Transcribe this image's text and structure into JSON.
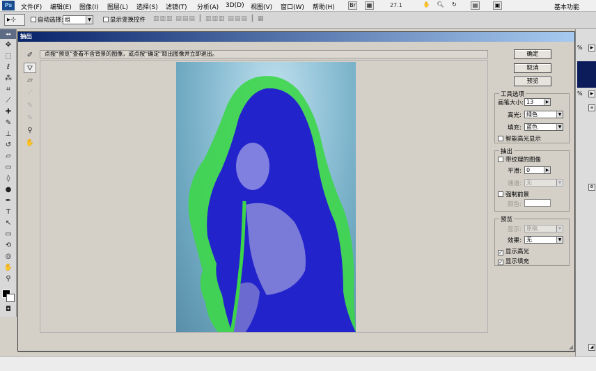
{
  "menubar": {
    "logo": "Ps",
    "items": [
      "文件(F)",
      "编辑(E)",
      "图像(I)",
      "图层(L)",
      "选择(S)",
      "滤镜(T)",
      "分析(A)",
      "3D(D)",
      "视图(V)",
      "窗口(W)",
      "帮助(H)"
    ],
    "zoom": "27.1",
    "workspace": "基本功能"
  },
  "optionsbar": {
    "auto_select_label": "自动选择:",
    "auto_select_value": "组",
    "show_transform_label": "显示变换控件"
  },
  "dialog": {
    "title": "抽出",
    "instruction": "点按“预览”查看不含背景的图像，或点按“确定”取出图像并立即退出。",
    "buttons": {
      "ok": "确定",
      "cancel": "取消",
      "preview": "预览"
    },
    "tool_options": {
      "title": "工具选项",
      "brush_size_label": "画笔大小:",
      "brush_size_value": "13",
      "highlight_label": "高光:",
      "highlight_value": "绿色",
      "fill_label": "填充:",
      "fill_value": "蓝色",
      "smart_highlight_label": "智能高光显示",
      "smart_highlight_checked": false
    },
    "extraction": {
      "title": "抽出",
      "textured_label": "带纹理的图像",
      "textured_checked": false,
      "smooth_label": "平滑:",
      "smooth_value": "0",
      "channel_label": "通道:",
      "channel_value": "无",
      "force_fg_label": "强制前景",
      "force_fg_checked": false,
      "color_label": "颜色:"
    },
    "preview": {
      "title": "预览",
      "show_label": "显示:",
      "show_value": "原稿",
      "effect_label": "效果:",
      "effect_value": "无",
      "show_highlight_label": "显示高光",
      "show_highlight_checked": true,
      "show_fill_label": "显示填充",
      "show_fill_checked": true
    }
  },
  "rightpanel": {
    "zoom1": "%",
    "zoom2": "%"
  },
  "colors": {
    "highlight_green": "#3dd64a",
    "fill_blue": "#2a2ad0",
    "title_blue": "#0a246a"
  }
}
